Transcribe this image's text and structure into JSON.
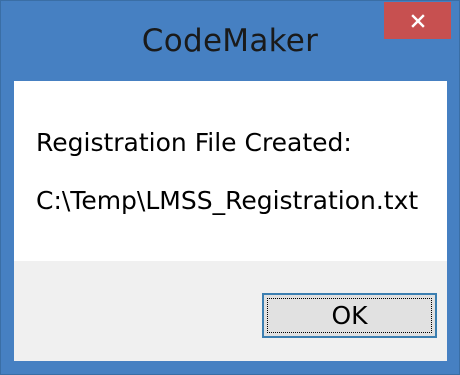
{
  "window": {
    "title": "CodeMaker",
    "frame_color": "#4680c2",
    "close_button_color": "#c75050",
    "close_icon": "close-icon"
  },
  "message": {
    "line1": "Registration File Created:",
    "line2": "C:\\Temp\\LMSS_Registration.txt"
  },
  "buttons": {
    "ok_label": "OK"
  }
}
